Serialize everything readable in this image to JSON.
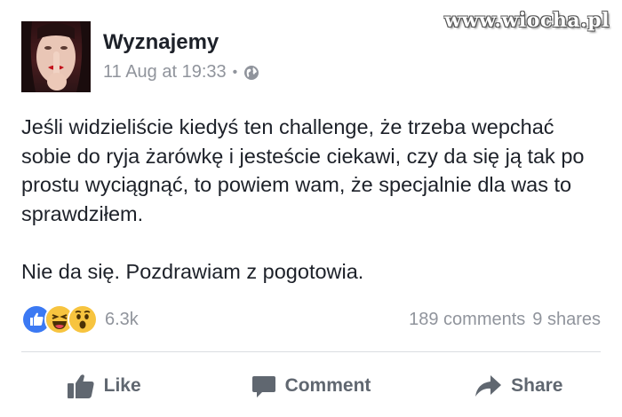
{
  "watermark": "www.wiocha.pl",
  "post": {
    "author": "Wyznajemy",
    "timestamp": "11 Aug at 19:33",
    "separator": "•",
    "privacy_icon": "globe-icon",
    "paragraphs": [
      "Jeśli widzieliście kiedyś ten challenge, że trzeba wepchać sobie do ryja żarówkę i jesteście ciekawi, czy da się ją tak po prostu wyciągnąć, to powiem wam, że specjalnie dla was to sprawdziłem.",
      "Nie da się. Pozdrawiam z pogotowia."
    ]
  },
  "stats": {
    "reactions": [
      "like",
      "haha",
      "wow"
    ],
    "reaction_count": "6.3k",
    "comments": "189 comments",
    "shares": "9 shares"
  },
  "actions": {
    "like": "Like",
    "comment": "Comment",
    "share": "Share"
  },
  "colors": {
    "like_blue": "#3b79f3",
    "emoji_yellow": "#f7c43f",
    "muted_text": "#90949c",
    "action_text": "#606770"
  }
}
